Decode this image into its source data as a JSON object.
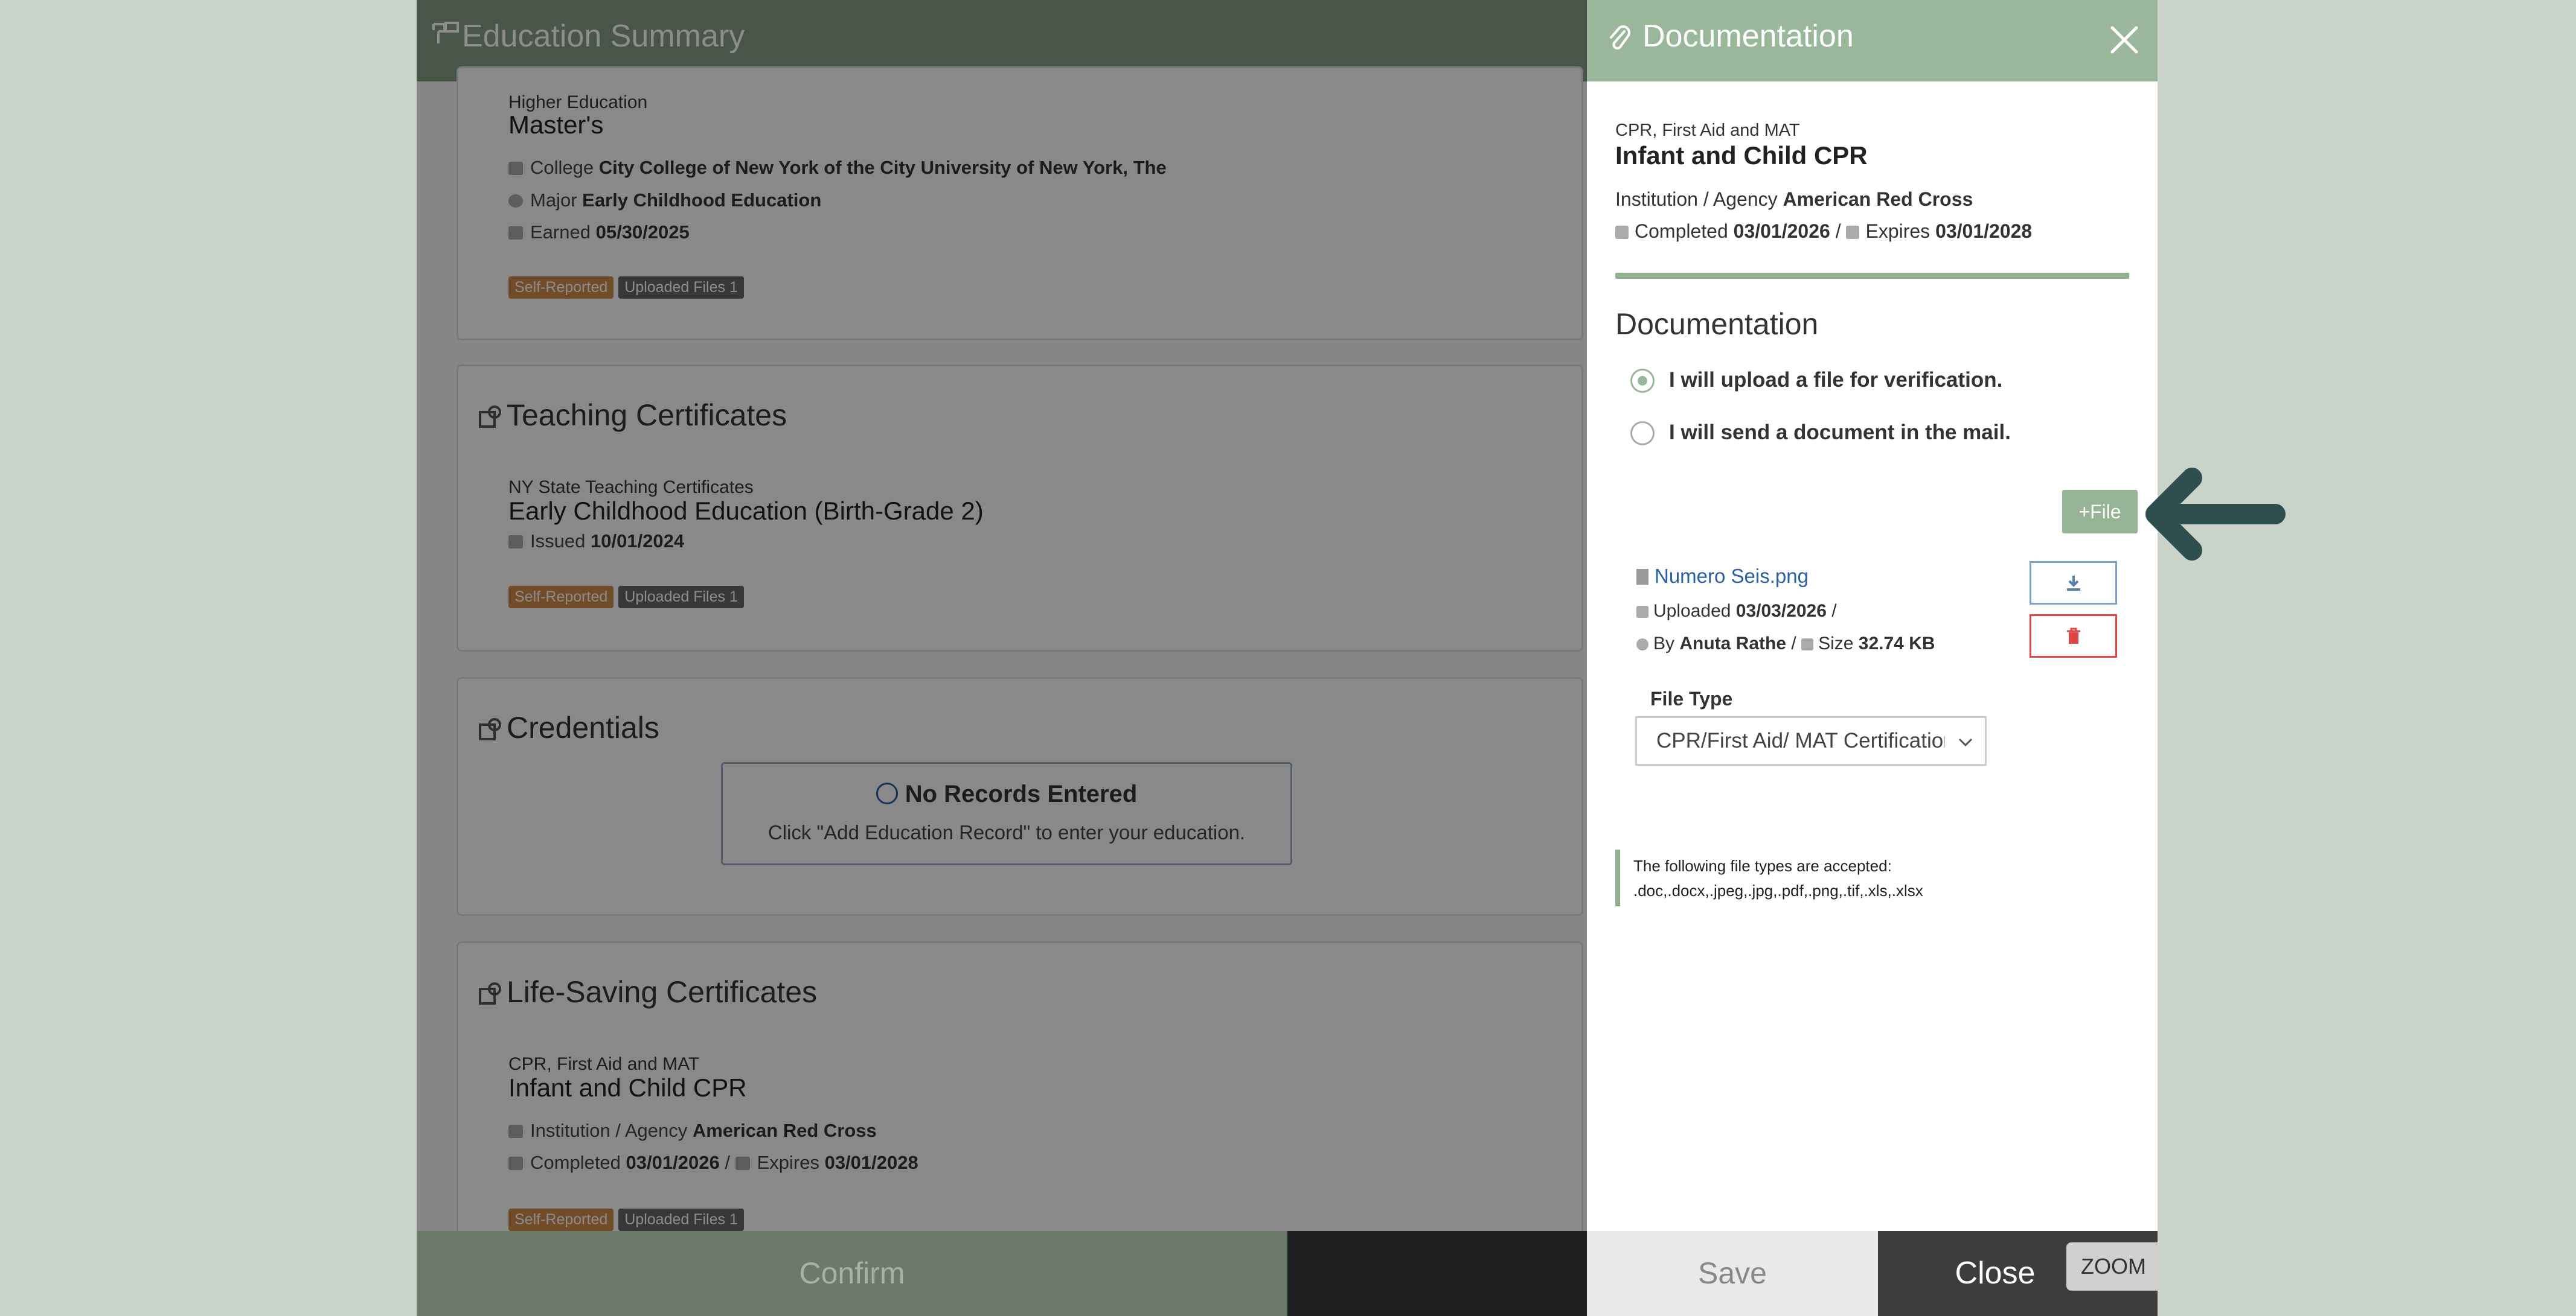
{
  "app": {
    "title": "Education Summary"
  },
  "records": {
    "higher": {
      "category": "Higher Education",
      "title": "Master's",
      "college_label": "College",
      "college_value": "City College of New York of the City University of New York, The",
      "major_label": "Major",
      "major_value": "Early Childhood Education",
      "earned_label": "Earned",
      "earned_value": "05/30/2025",
      "tag_self": "Self-Reported",
      "tag_files": "Uploaded Files 1"
    },
    "teaching": {
      "section": "Teaching Certificates",
      "category": "NY State Teaching Certificates",
      "title": "Early Childhood Education (Birth-Grade 2)",
      "issued_label": "Issued",
      "issued_value": "10/01/2024",
      "tag_self": "Self-Reported",
      "tag_files": "Uploaded Files 1"
    },
    "credentials": {
      "section": "Credentials",
      "empty_title": "No Records Entered",
      "empty_text": "Click \"Add Education Record\" to enter your education."
    },
    "lifesaving": {
      "section": "Life-Saving Certificates",
      "category": "CPR, First Aid and MAT",
      "title": "Infant and Child CPR",
      "institution_label": "Institution / Agency",
      "institution_value": "American Red Cross",
      "completed_label": "Completed",
      "completed_value": "03/01/2026",
      "sep": "/",
      "expires_label": "Expires",
      "expires_value": "03/01/2028",
      "tag_self": "Self-Reported",
      "tag_files": "Uploaded Files 1"
    }
  },
  "footer": {
    "confirm": "Confirm"
  },
  "drawer": {
    "title": "Documentation",
    "record": {
      "category": "CPR, First Aid and MAT",
      "title": "Infant and Child CPR",
      "institution_label": "Institution / Agency",
      "institution_value": "American Red Cross",
      "completed_label": "Completed",
      "completed_value": "03/01/2026",
      "sep": "/",
      "expires_label": "Expires",
      "expires_value": "03/01/2028"
    },
    "section_title": "Documentation",
    "options": [
      {
        "label": "I will upload a file for verification.",
        "selected": true
      },
      {
        "label": "I will send a document in the mail.",
        "selected": false
      }
    ],
    "file_button": "+File",
    "file": {
      "name": "Numero Seis.png",
      "uploaded_label": "Uploaded",
      "uploaded_value": "03/03/2026",
      "sep": "/",
      "by_label": "By",
      "by_value": "Anuta Rathe",
      "size_label": "Size",
      "size_value": "32.74 KB"
    },
    "file_type_label": "File Type",
    "file_type_value": "CPR/First Aid/ MAT Certification",
    "note_line1": "The following file types are accepted:",
    "note_line2": ".doc,.docx,.jpeg,.jpg,.pdf,.png,.tif,.xls,.xlsx",
    "save": "Save",
    "close": "Close",
    "zoom": "ZOOM"
  },
  "colors": {
    "header_green": "#889c88",
    "drawer_green": "#9bb79b",
    "arrow": "#2f4f4f",
    "link_blue": "#2a5fa0",
    "delete_red": "#dd4444"
  }
}
